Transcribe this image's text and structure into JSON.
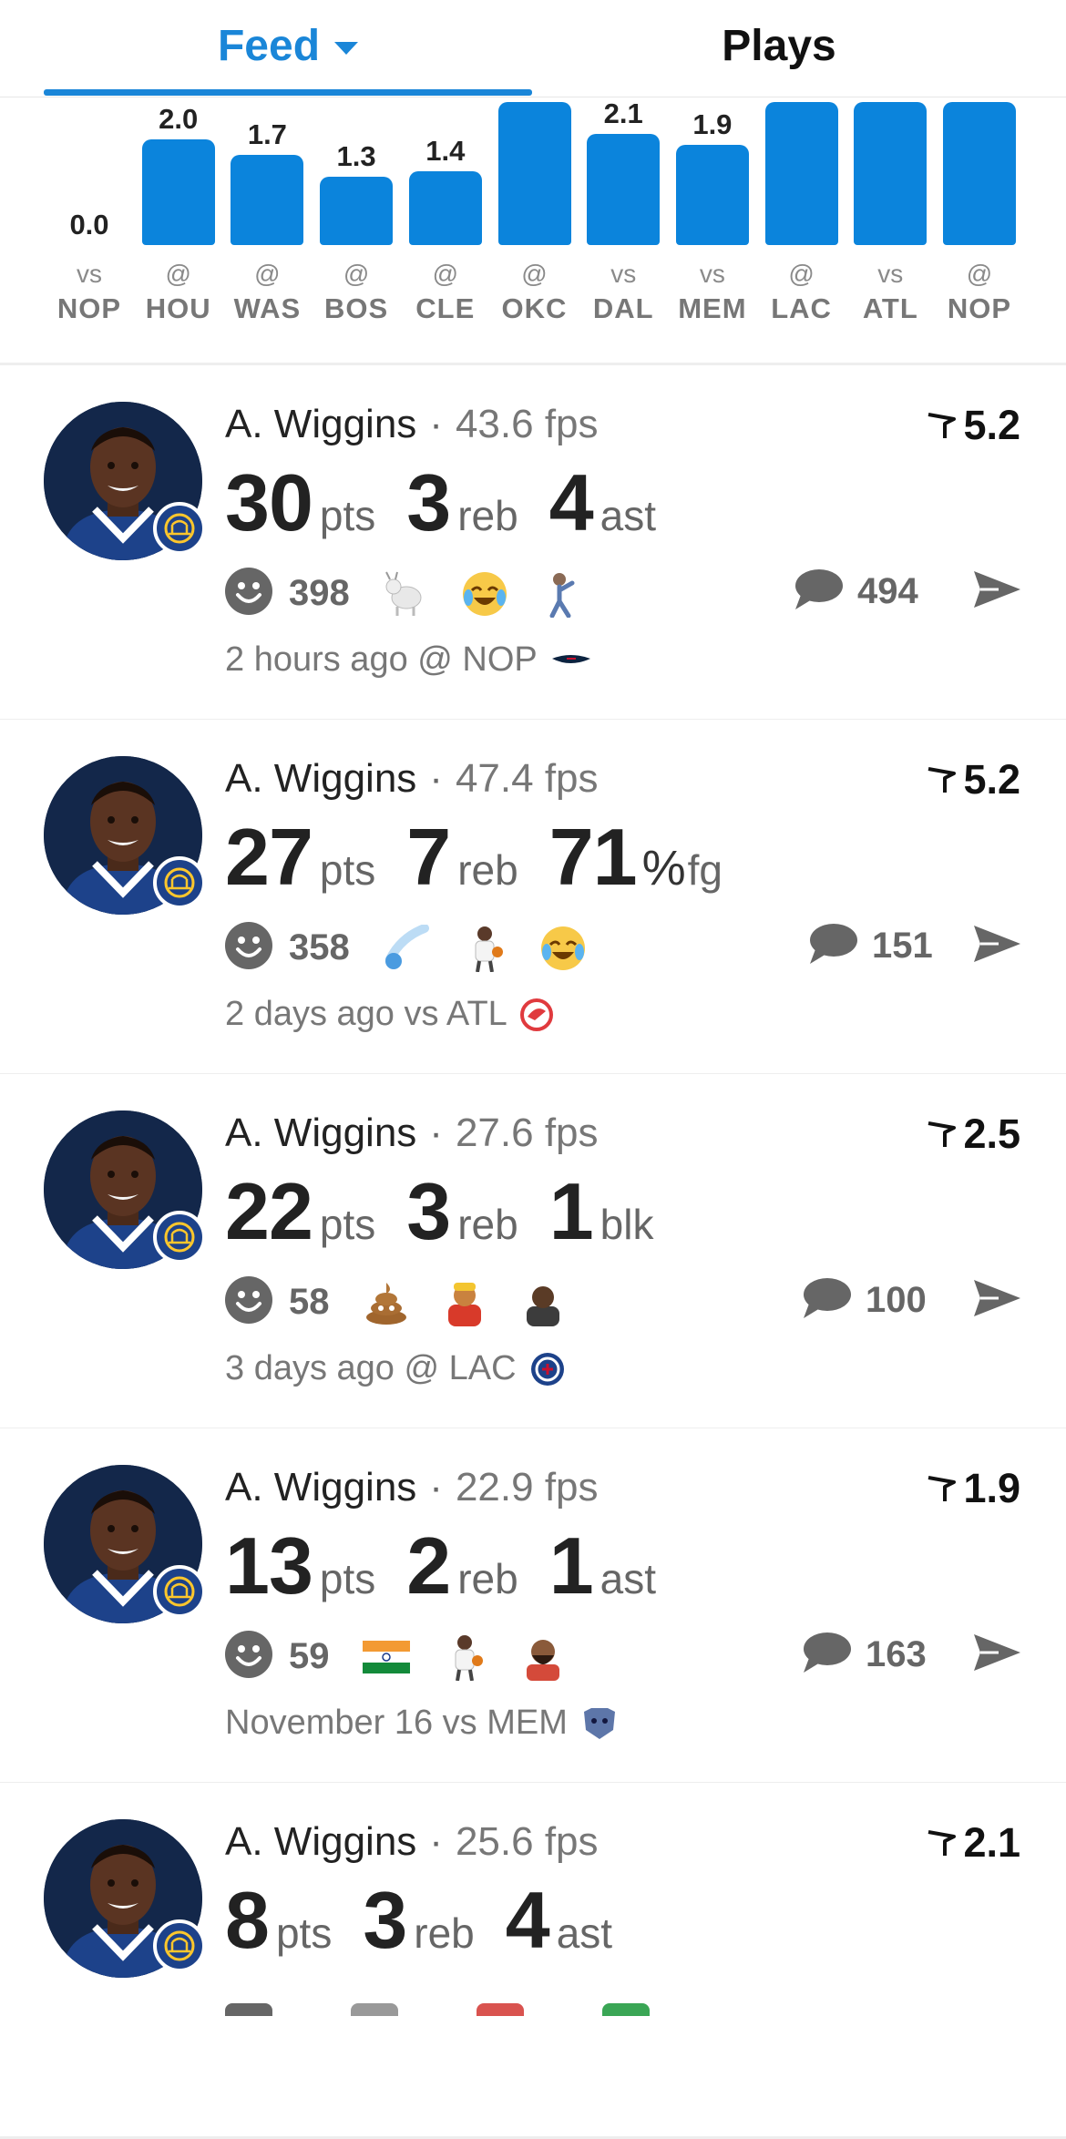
{
  "tabs": {
    "feed": "Feed",
    "plays": "Plays"
  },
  "chart_data": {
    "type": "bar",
    "categories": [
      "vs NOP",
      "@ HOU",
      "@ WAS",
      "@ BOS",
      "@ CLE",
      "@ OKC",
      "vs DAL",
      "vs MEM",
      "@ LAC",
      "vs ATL",
      "@ NOP"
    ],
    "home_away": [
      "vs",
      "@",
      "@",
      "@",
      "@",
      "@",
      "vs",
      "vs",
      "@",
      "vs",
      "@"
    ],
    "opponents": [
      "NOP",
      "HOU",
      "WAS",
      "BOS",
      "CLE",
      "OKC",
      "DAL",
      "MEM",
      "LAC",
      "ATL",
      "NOP"
    ],
    "labels": [
      "0.0",
      "2.0",
      "1.7",
      "1.3",
      "1.4",
      "",
      "2.1",
      "1.9",
      "",
      "",
      ""
    ],
    "values": [
      0.0,
      2.0,
      1.7,
      1.3,
      1.4,
      2.7,
      2.1,
      1.9,
      2.7,
      2.7,
      2.7
    ],
    "xlabel": "",
    "ylabel": "",
    "grid": false
  },
  "feed": [
    {
      "player": "A. Wiggins",
      "fps": "43.6 fps",
      "score": "5.2",
      "stats": [
        {
          "n": "30",
          "u": "pts"
        },
        {
          "n": "3",
          "u": "reb"
        },
        {
          "n": "4",
          "u": "ast"
        }
      ],
      "reactions": "398",
      "emojis": [
        "goat",
        "joy",
        "pose"
      ],
      "comments": "494",
      "time": "2 hours ago @ NOP",
      "team_logo": "pelicans"
    },
    {
      "player": "A. Wiggins",
      "fps": "47.4 fps",
      "score": "5.2",
      "stats": [
        {
          "n": "27",
          "u": "pts"
        },
        {
          "n": "7",
          "u": "reb"
        },
        {
          "n": "71",
          "pct": "%",
          "u": "fg"
        }
      ],
      "reactions": "358",
      "emojis": [
        "comet",
        "player",
        "joy"
      ],
      "comments": "151",
      "time": "2 days ago vs ATL",
      "team_logo": "hawks"
    },
    {
      "player": "A. Wiggins",
      "fps": "27.6 fps",
      "score": "2.5",
      "stats": [
        {
          "n": "22",
          "u": "pts"
        },
        {
          "n": "3",
          "u": "reb"
        },
        {
          "n": "1",
          "u": "blk"
        }
      ],
      "reactions": "58",
      "emojis": [
        "poop",
        "wrestler",
        "man"
      ],
      "comments": "100",
      "time": "3 days ago @ LAC",
      "team_logo": "clippers"
    },
    {
      "player": "A. Wiggins",
      "fps": "22.9 fps",
      "score": "1.9",
      "stats": [
        {
          "n": "13",
          "u": "pts"
        },
        {
          "n": "2",
          "u": "reb"
        },
        {
          "n": "1",
          "u": "ast"
        }
      ],
      "reactions": "59",
      "emojis": [
        "india-flag",
        "player",
        "beard"
      ],
      "comments": "163",
      "time": "November 16 vs MEM",
      "team_logo": "grizzlies"
    },
    {
      "player": "A. Wiggins",
      "fps": "25.6 fps",
      "score": "2.1",
      "stats": [
        {
          "n": "8",
          "u": "pts"
        },
        {
          "n": "3",
          "u": "reb"
        },
        {
          "n": "4",
          "u": "ast"
        }
      ],
      "reactions": "",
      "emojis": [],
      "comments": "",
      "time": "",
      "team_logo": ""
    }
  ]
}
